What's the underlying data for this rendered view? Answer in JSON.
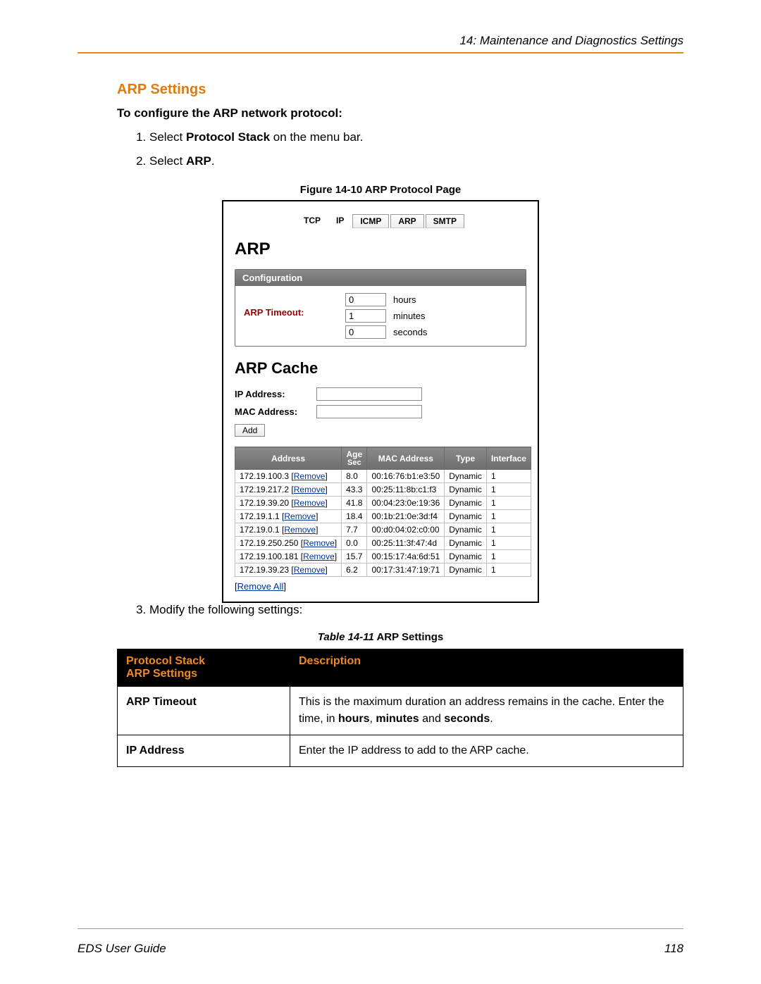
{
  "header": {
    "chapter": "14: Maintenance and Diagnostics Settings"
  },
  "section": {
    "title": "ARP Settings",
    "subhead": "To configure the ARP network protocol:",
    "step1_pre": "Select ",
    "step1_bold": "Protocol Stack",
    "step1_post": " on the menu bar.",
    "step2_pre": "Select ",
    "step2_bold": "ARP",
    "step2_post": ".",
    "step3": "Modify the following settings:"
  },
  "figure": {
    "caption": "Figure 14-10  ARP Protocol Page",
    "tabs": [
      "TCP",
      "IP",
      "ICMP",
      "ARP",
      "SMTP"
    ],
    "panel_title": "ARP",
    "config_header": "Configuration",
    "arp_timeout_label": "ARP Timeout:",
    "timeout": {
      "hours": "0",
      "minutes": "1",
      "seconds": "0"
    },
    "hours_label": "hours",
    "minutes_label": "minutes",
    "seconds_label": "seconds",
    "cache_title": "ARP Cache",
    "ip_label": "IP Address:",
    "mac_label": "MAC Address:",
    "add_label": "Add",
    "columns": {
      "address": "Address",
      "age": "Age",
      "age_sub": "Sec",
      "mac": "MAC Address",
      "type": "Type",
      "iface": "Interface"
    },
    "remove_label": "Remove",
    "rows": [
      {
        "ip": "172.19.100.3",
        "age": "8.0",
        "mac": "00:16:76:b1:e3:50",
        "type": "Dynamic",
        "iface": "1"
      },
      {
        "ip": "172.19.217.2",
        "age": "43.3",
        "mac": "00:25:11:8b:c1:f3",
        "type": "Dynamic",
        "iface": "1"
      },
      {
        "ip": "172.19.39.20",
        "age": "41.8",
        "mac": "00:04:23:0e:19:36",
        "type": "Dynamic",
        "iface": "1"
      },
      {
        "ip": "172.19.1.1",
        "age": "18.4",
        "mac": "00:1b:21:0e:3d:f4",
        "type": "Dynamic",
        "iface": "1"
      },
      {
        "ip": "172.19.0.1",
        "age": "7.7",
        "mac": "00:d0:04:02:c0:00",
        "type": "Dynamic",
        "iface": "1"
      },
      {
        "ip": "172.19.250.250",
        "age": "0.0",
        "mac": "00:25:11:3f:47:4d",
        "type": "Dynamic",
        "iface": "1"
      },
      {
        "ip": "172.19.100.181",
        "age": "15.7",
        "mac": "00:15:17:4a:6d:51",
        "type": "Dynamic",
        "iface": "1"
      },
      {
        "ip": "172.19.39.23",
        "age": "6.2",
        "mac": "00:17:31:47:19:71",
        "type": "Dynamic",
        "iface": "1"
      }
    ],
    "remove_all": "Remove All"
  },
  "table_caption": {
    "prefix": "Table 14-11",
    "title": "  ARP Settings"
  },
  "settings_table": {
    "head_left_line1": "Protocol Stack",
    "head_left_line2": "ARP Settings",
    "head_right": "Description",
    "rows": [
      {
        "left": "ARP Timeout",
        "right_pre": "This is the maximum duration an address remains in the cache. Enter the time, in ",
        "right_bold1": "hours",
        "right_mid1": ", ",
        "right_bold2": "minutes",
        "right_mid2": " and ",
        "right_bold3": "seconds",
        "right_post": "."
      },
      {
        "left": "IP Address",
        "right_pre": "Enter the IP address to add to the ARP cache.",
        "right_bold1": "",
        "right_mid1": "",
        "right_bold2": "",
        "right_mid2": "",
        "right_bold3": "",
        "right_post": ""
      }
    ]
  },
  "footer": {
    "left": "EDS User Guide",
    "right": "118"
  }
}
